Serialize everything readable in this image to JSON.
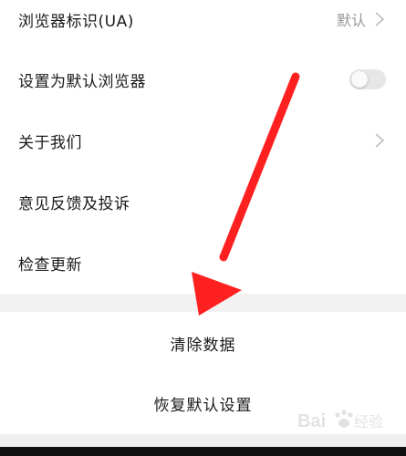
{
  "settings": {
    "rows": [
      {
        "label": "浏览器标识(UA)",
        "value": "默认",
        "trailing": "chevron-right-icon"
      },
      {
        "label": "设置为默认浏览器",
        "toggle_on": false
      },
      {
        "label": "关于我们",
        "trailing": "chevron-right-icon"
      },
      {
        "label": "意见反馈及投诉"
      },
      {
        "label": "检查更新"
      }
    ]
  },
  "actions": {
    "clear_data": "清除数据",
    "restore_defaults": "恢复默认设置"
  },
  "annotation": {
    "arrow_color": "#ff2020"
  },
  "colors": {
    "separator": "#f2f2f2",
    "secondary_text": "#999999"
  },
  "watermark": {
    "brand": "Baidu 经验"
  }
}
